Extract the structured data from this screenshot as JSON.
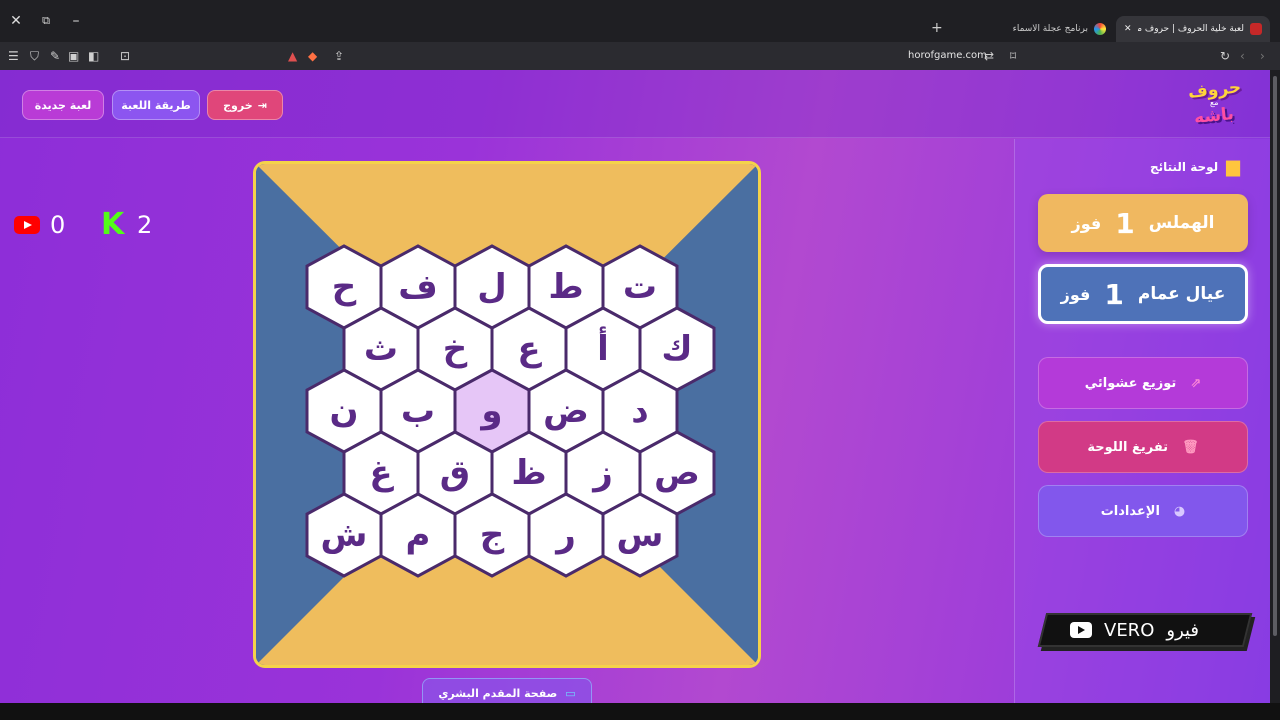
{
  "browser": {
    "tabs": [
      {
        "title": "لعبة خلية الحروف | حروف مع عزيز",
        "active": true
      },
      {
        "title": "برنامج عجلة الاسماء",
        "active": false
      }
    ],
    "url": "horofgame.com",
    "close_glyph": "✕",
    "new_tab_glyph": "+"
  },
  "header": {
    "logo": {
      "line1": "حروف",
      "line2": "مع",
      "line3": "باشه"
    },
    "exit_label": "خروج",
    "howto_label": "طريقة اللعبة",
    "newgame_label": "لعبة جديدة"
  },
  "scores": {
    "youtube": "0",
    "kick": "2"
  },
  "board": {
    "rows": [
      [
        "ح",
        "ف",
        "ل",
        "ط",
        "ت"
      ],
      [
        "ث",
        "خ",
        "ع",
        "أ",
        "ك"
      ],
      [
        "ن",
        "ب",
        "و",
        "ض",
        "د"
      ],
      [
        "غ",
        "ق",
        "ظ",
        "ز",
        "ص"
      ],
      [
        "ش",
        "م",
        "ج",
        "ر",
        "س"
      ]
    ],
    "highlighted": "و",
    "colors": {
      "gold": "#efbd5d",
      "blue": "#4a6fa1",
      "hex_fill": "#ffffff",
      "hex_stroke": "#4a2a6b",
      "hex_hover": "#e6c6f7",
      "letter": "#5a2a86"
    }
  },
  "presenter_label": "صفحة المقدم البشري",
  "sidebar": {
    "results_title": "لوحة النتائج",
    "teams": [
      {
        "name": "الهملس",
        "wins": "1",
        "win_label": "فوز",
        "color": "#f0b860"
      },
      {
        "name": "عيال عمام",
        "wins": "1",
        "win_label": "فوز",
        "color": "#4e72b8"
      }
    ],
    "actions": {
      "shuffle": "توزيع عشوائي",
      "clear": "تفريغ اللوحة",
      "settings": "الإعدادات"
    },
    "vero": {
      "brand": "VERO",
      "arabic": "فيرو"
    }
  }
}
